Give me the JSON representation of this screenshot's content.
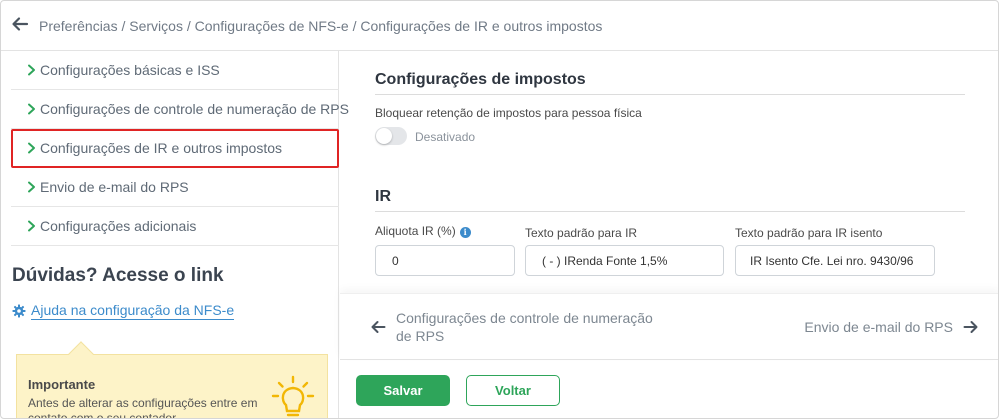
{
  "header": {
    "breadcrumb": "Preferências / Serviços / Configurações de NFS-e / Configurações de IR e outros impostos"
  },
  "sidebar": {
    "items": [
      {
        "label": "Configurações básicas e ISS",
        "active": false
      },
      {
        "label": "Configurações de controle de numeração de RPS",
        "active": false
      },
      {
        "label": "Configurações de IR e outros impostos",
        "active": true
      },
      {
        "label": "Envio de e-mail do RPS",
        "active": false
      },
      {
        "label": "Configurações adicionais",
        "active": false
      }
    ],
    "help_title": "Dúvidas? Acesse o link",
    "help_link": "Ajuda na configuração da NFS-e",
    "note": {
      "title": "Importante",
      "text": "Antes de alterar as configurações entre em contato com o seu contador"
    }
  },
  "main": {
    "taxes_section": {
      "title": "Configurações de impostos",
      "block_label": "Bloquear retenção de impostos para pessoa física",
      "toggle_state": "Desativado",
      "toggle_on": false
    },
    "ir_section": {
      "title": "IR",
      "rate_label": "Aliquota IR (%)",
      "rate_value": "0",
      "default_text_label": "Texto padrão para IR",
      "default_text_value": "( - ) IRenda Fonte 1,5%",
      "exempt_text_label": "Texto padrão para IR isento",
      "exempt_text_value": "IR Isento Cfe. Lei nro. 9430/96"
    },
    "pager": {
      "prev_label": "Configurações de controle de numeração de RPS",
      "next_label": "Envio de e-mail do RPS"
    },
    "actions": {
      "save_label": "Salvar",
      "back_label": "Voltar"
    }
  },
  "colors": {
    "accent_green": "#2ea55a",
    "link_blue": "#3c8bcb",
    "active_outline": "#e02424",
    "note_bg": "#fdf3c8"
  },
  "icons": {
    "back": "arrow-left-icon",
    "chevron": "chevron-right-icon",
    "gear": "gear-icon",
    "info": "info-icon",
    "bulb": "lightbulb-icon"
  }
}
